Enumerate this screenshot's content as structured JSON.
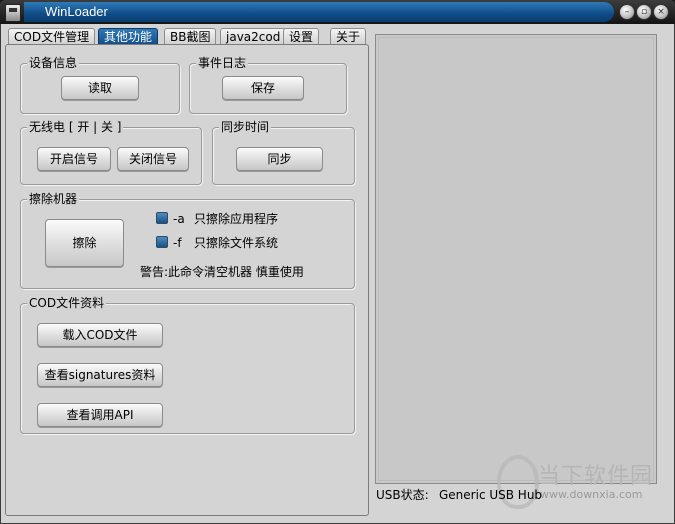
{
  "window": {
    "title": "WinLoader"
  },
  "titlebar_buttons": [
    "minimize-icon",
    "restore-icon",
    "close-icon"
  ],
  "tabs": [
    {
      "label": "COD文件管理"
    },
    {
      "label": "其他功能",
      "active": true
    },
    {
      "label": "BB截图"
    },
    {
      "label": "java2cod"
    },
    {
      "label": "设置"
    },
    {
      "label": "关于"
    }
  ],
  "device_info": {
    "title": "设备信息",
    "read_label": "读取"
  },
  "event_log": {
    "title": "事件日志",
    "save_label": "保存"
  },
  "radio": {
    "title": "无线电 [ 开 | 关 ]",
    "on_label": "开启信号",
    "off_label": "关闭信号"
  },
  "sync_time": {
    "title": "同步时间",
    "sync_label": "同步"
  },
  "wipe": {
    "title": "擦除机器",
    "button_label": "擦除",
    "option_a_flag": "-a",
    "option_a_label": "只擦除应用程序",
    "option_f_flag": "-f",
    "option_f_label": "只擦除文件系统",
    "warning": "警告:此命令清空机器 慎重使用"
  },
  "cod_info": {
    "title": "COD文件资料",
    "load_label": "载入COD文件",
    "signatures_label": "查看signatures资料",
    "api_label": "查看调用API"
  },
  "status_bar": {
    "usb_label": "USB状态:",
    "usb_value": "Generic USB Hub"
  },
  "watermark": {
    "text": "当下软件园",
    "url": "www.downxia.com"
  },
  "colors": {
    "accent": "#0f4c86",
    "face": "#d4d4d4"
  }
}
